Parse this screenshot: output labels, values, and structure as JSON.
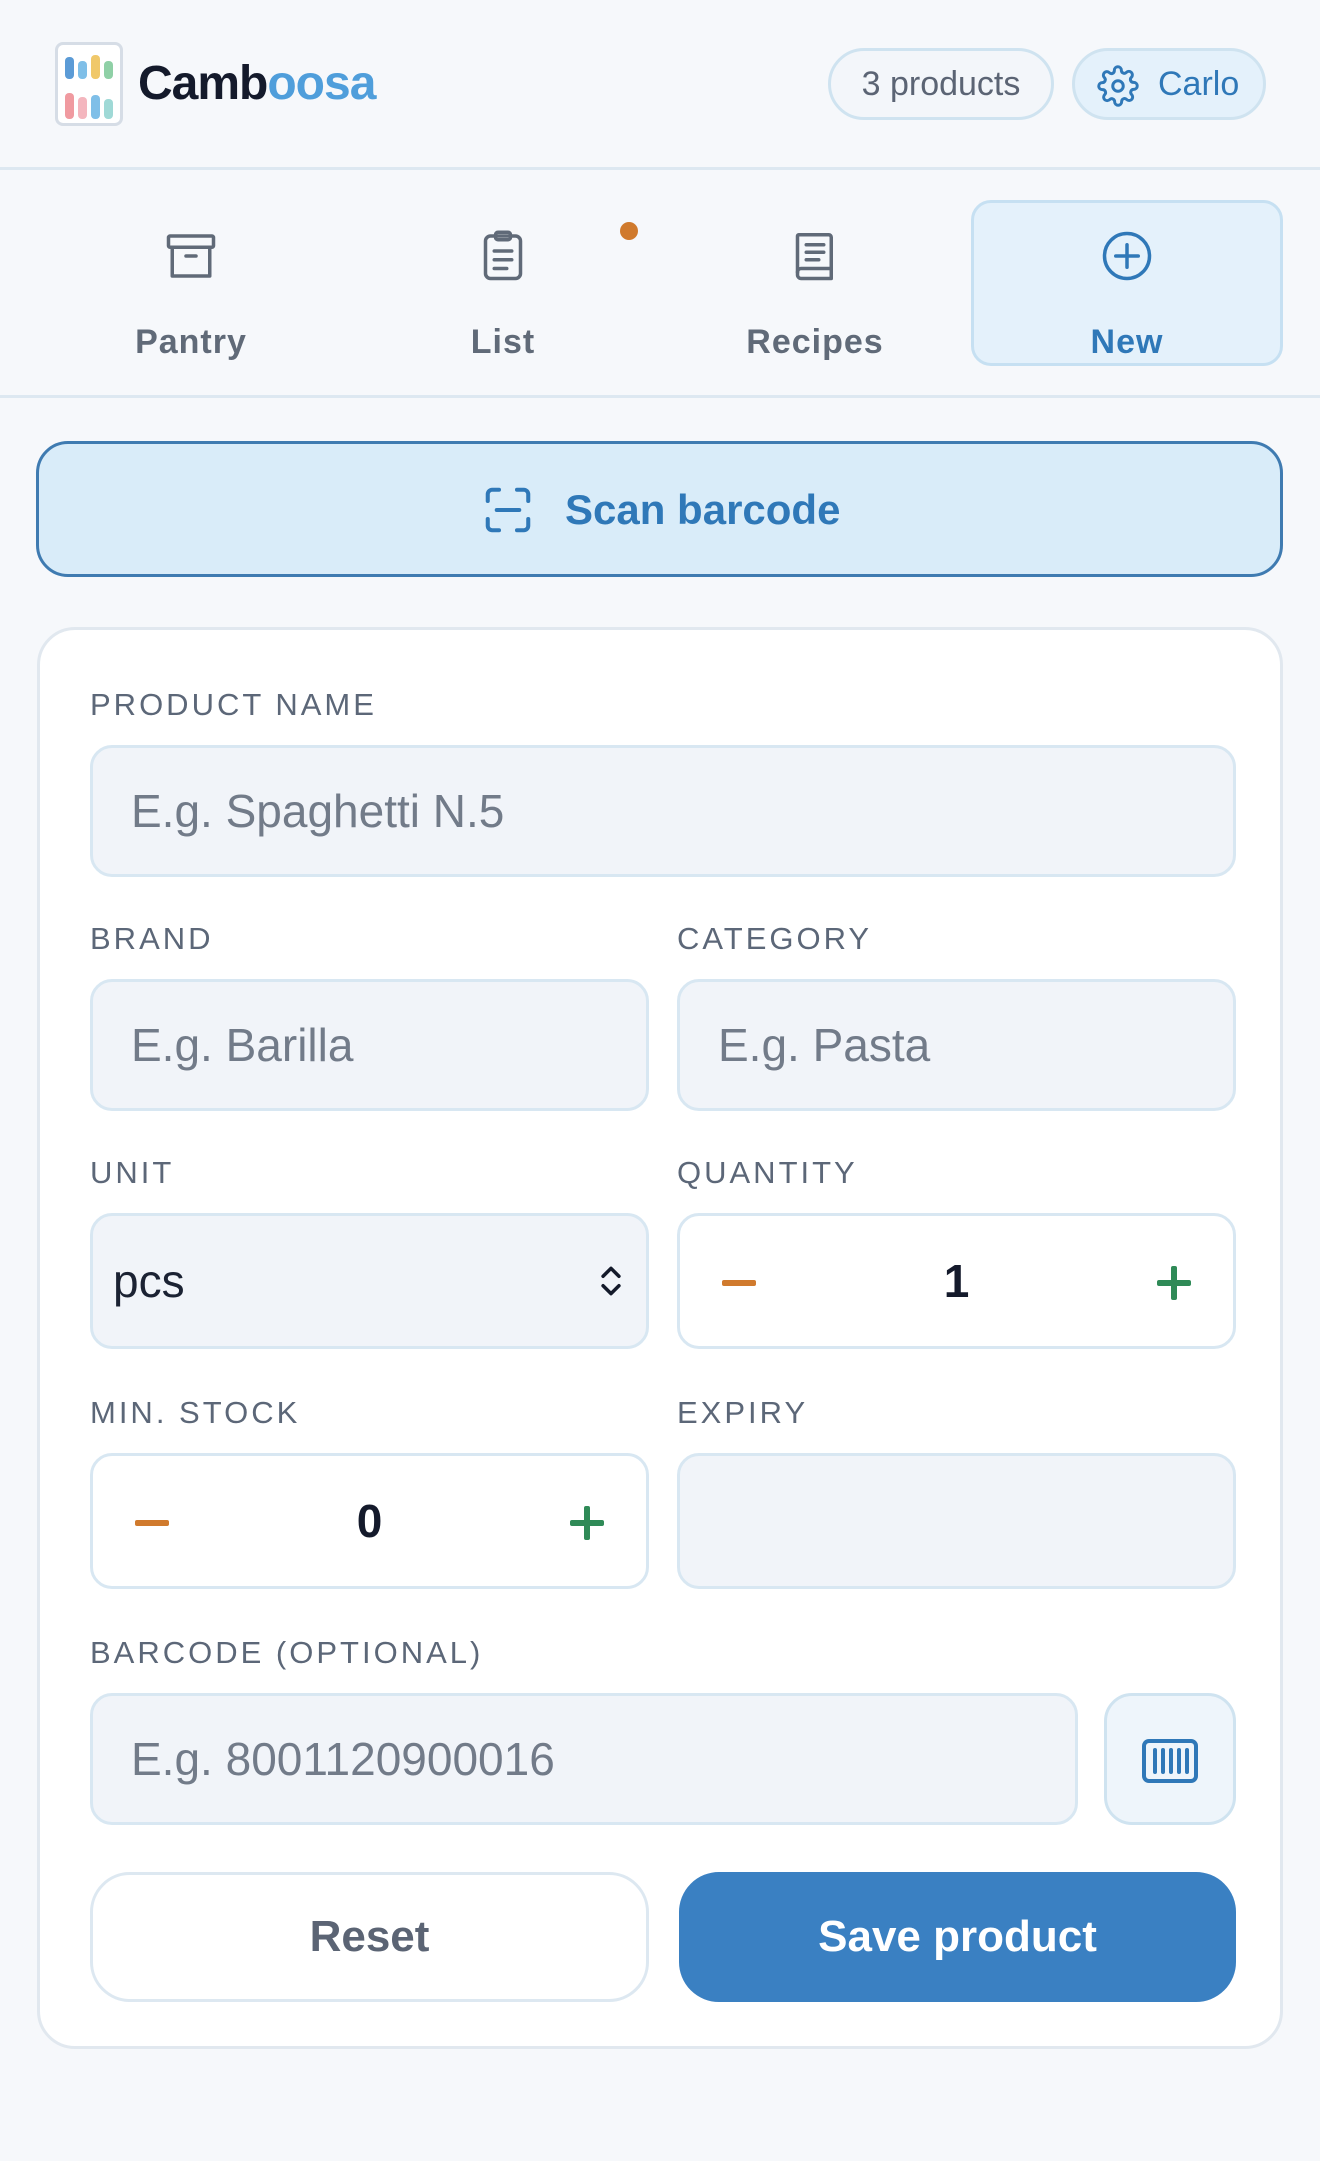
{
  "header": {
    "brand_part1": "Camb",
    "brand_part2": "oosa",
    "products_pill": "3 products",
    "user_name": "Carlo"
  },
  "nav": {
    "tabs": [
      {
        "label": "Pantry",
        "icon": "archive-box-icon",
        "active": false
      },
      {
        "label": "List",
        "icon": "clipboard-icon",
        "active": false,
        "has_notification_dot": true
      },
      {
        "label": "Recipes",
        "icon": "book-icon",
        "active": false
      },
      {
        "label": "New",
        "icon": "plus-circle-icon",
        "active": true
      }
    ]
  },
  "scan_button": {
    "label": "Scan barcode",
    "icon": "scan-icon"
  },
  "form": {
    "product_name": {
      "label": "PRODUCT NAME",
      "placeholder": "E.g. Spaghetti N.5",
      "value": ""
    },
    "brand": {
      "label": "BRAND",
      "placeholder": "E.g. Barilla",
      "value": ""
    },
    "category": {
      "label": "CATEGORY",
      "placeholder": "E.g. Pasta",
      "value": ""
    },
    "unit": {
      "label": "UNIT",
      "value": "pcs"
    },
    "quantity": {
      "label": "QUANTITY",
      "value": "1"
    },
    "min_stock": {
      "label": "MIN. STOCK",
      "value": "0"
    },
    "expiry": {
      "label": "EXPIRY",
      "value": ""
    },
    "barcode": {
      "label": "BARCODE (OPTIONAL)",
      "placeholder": "E.g. 8001120900016",
      "value": ""
    }
  },
  "actions": {
    "reset_label": "Reset",
    "save_label": "Save product"
  },
  "colors": {
    "accent": "#3a80c2",
    "accent_light": "#d9ecf9",
    "minus": "#d07a2d",
    "plus": "#2f8a57",
    "notification_dot": "#d07a2d"
  }
}
